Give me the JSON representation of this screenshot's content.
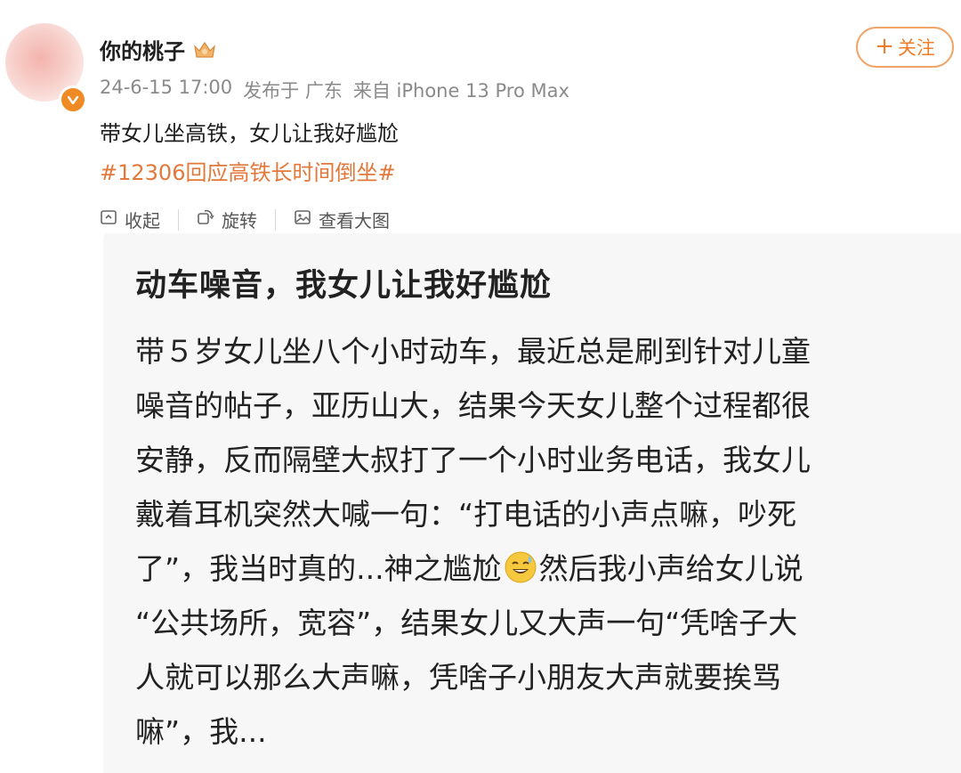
{
  "user": {
    "name": "你的桃子",
    "icons": {
      "avatar": "avatar-image",
      "badge": "verified-badge-icon",
      "crown": "crown-icon"
    }
  },
  "meta": {
    "time": "24-6-15 17:00",
    "location": "发布于 广东",
    "device": "来自 iPhone 13 Pro Max"
  },
  "follow_button": {
    "plus": "+",
    "label": "关注"
  },
  "post": {
    "text": "带女儿坐高铁，女儿让我好尴尬",
    "hashtag": "#12306回应高铁长时间倒坐#"
  },
  "toolbar": {
    "collapse": "收起",
    "rotate": "旋转",
    "view_large": "查看大图"
  },
  "image_card": {
    "title": "动车噪音，我女儿让我好尴尬",
    "lines": [
      "带５岁女儿坐八个小时动车，最近总是刷到针对儿童",
      "噪音的帖子，亚历山大，结果今天女儿整个过程都很",
      "安静，反而隔壁大叔打了一个小时业务电话，我女儿",
      "戴着耳机突然大喊一句：“打电话的小声点嘛，吵死",
      "了”，我当时真的...神之尴尬",
      "“公共场所，宽容”，结果女儿又大声一句“凭啥子大",
      "人就可以那么大声嘛，凭啥子小朋友大声就要挨骂",
      "嘛”，我..."
    ],
    "line5_after_emoji": "然后我小声给女儿说",
    "emoji": "sweat-smile-emoji"
  },
  "colors": {
    "accent_orange": "#ef7d2a",
    "hashtag": "#e2783a",
    "card_bg": "#f7f7f7"
  }
}
